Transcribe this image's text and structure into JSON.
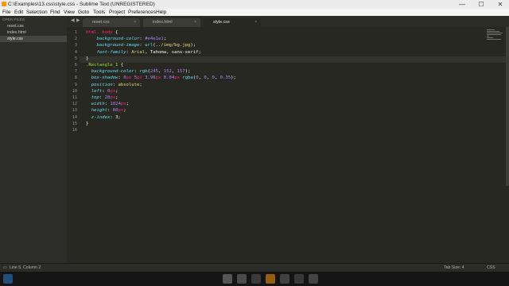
{
  "window": {
    "title": "C:\\Examples\\13.css\\style.css - Sublime Text (UNREGISTERED)",
    "controls": {
      "minimize": "—",
      "maximize": "☐",
      "close": "✕"
    }
  },
  "menu": [
    "File",
    "Edit",
    "Selection",
    "Find",
    "View",
    "Goto",
    "Tools",
    "Project",
    "Preferences",
    "Help"
  ],
  "sidebar": {
    "section_label": "OPEN FILES",
    "files": [
      {
        "name": "reset.css",
        "active": false
      },
      {
        "name": "index.html",
        "active": false
      },
      {
        "name": "style.css",
        "active": true
      }
    ]
  },
  "tabs": [
    {
      "label": "reset.css",
      "close": "×",
      "active": false
    },
    {
      "label": "index.html",
      "close": "×",
      "active": false
    },
    {
      "label": "style.css",
      "close": "×",
      "active": true
    }
  ],
  "tab_nav": {
    "prev": "◀",
    "next": "▶"
  },
  "editor": {
    "current_line": 5,
    "lines": [
      {
        "n": "1",
        "text": "html, body {"
      },
      {
        "n": "2",
        "text": "    background-color: #e4e1e1;"
      },
      {
        "n": "3",
        "text": "    background-image: url(../img/bg.jpg);"
      },
      {
        "n": "4",
        "text": "    font-family: Arial, Tahoma, sans-serif;"
      },
      {
        "n": "5",
        "text": "}"
      },
      {
        "n": "6",
        "text": ".Rectangle_1 {"
      },
      {
        "n": "7",
        "text": "  background-color: rgb(245, 152, 157);"
      },
      {
        "n": "8",
        "text": "  box-shadow: 0px 5px 3.96px 0.04px rgba(0, 0, 0, 0.35);"
      },
      {
        "n": "9",
        "text": "  position: absolute;"
      },
      {
        "n": "10",
        "text": "  left: 0px;"
      },
      {
        "n": "11",
        "text": "  top: 28px;"
      },
      {
        "n": "12",
        "text": "  width: 1024px;"
      },
      {
        "n": "13",
        "text": "  height: 80px;"
      },
      {
        "n": "14",
        "text": "  z-index: 3;"
      },
      {
        "n": "15",
        "text": "}"
      },
      {
        "n": "16",
        "text": ""
      }
    ]
  },
  "status": {
    "position": "Line 5, Column 2",
    "tab_size": "Tab Size: 4",
    "syntax": "CSS"
  },
  "colors": {
    "editor_bg": "#272822",
    "sidebar_bg": "#2d2d2a",
    "selector": "#f92672",
    "property": "#66d9ef",
    "string": "#e6db74",
    "number": "#ae81ff",
    "class": "#a6e22e"
  },
  "taskbar_icons": [
    "start-icon",
    "browser-icon",
    "files-icon",
    "media-icon",
    "sublime-icon",
    "chat-icon",
    "settings-icon",
    "photo-icon"
  ]
}
